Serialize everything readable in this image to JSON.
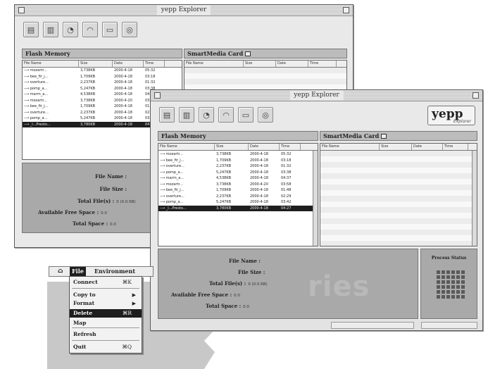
{
  "window_back": {
    "title": "yepp Explorer",
    "flash_header": "Flash Memory",
    "smart_header": "SmartMedia Card",
    "flash_columns": [
      "File Name",
      "Size",
      "Date",
      "Time"
    ],
    "smart_columns": [
      "File Name",
      "Size",
      "Date",
      "Time"
    ],
    "files": [
      {
        "name": "mozartr...",
        "size": "3,738KB",
        "date": "2000-4-18",
        "time": "05:32"
      },
      {
        "name": "bee_fir_j...",
        "size": "1,709KB",
        "date": "2000-4-18",
        "time": "03:18"
      },
      {
        "name": "overture...",
        "size": "2,237KB",
        "date": "2000-4-18",
        "time": "01:32"
      },
      {
        "name": "pomp_a...",
        "size": "5,247KB",
        "date": "2000-4-18",
        "time": "03:38"
      },
      {
        "name": "marrn_a...",
        "size": "4,538KB",
        "date": "2000-4-18",
        "time": "04:37"
      },
      {
        "name": "mozartr...",
        "size": "3,738KB",
        "date": "2000-4-20",
        "time": "03:58"
      },
      {
        "name": "bee_fir_j...",
        "size": "1,709KB",
        "date": "2000-4-18",
        "time": "01:48"
      },
      {
        "name": "overture...",
        "size": "2,237KB",
        "date": "2000-4-18",
        "time": "02:29"
      },
      {
        "name": "pomp_a...",
        "size": "5,247KB",
        "date": "2000-4-18",
        "time": "03:42"
      },
      {
        "name": "_l...Presto...",
        "size": "3,780KB",
        "date": "2000-4-18",
        "time": "04:27"
      }
    ],
    "info": {
      "file_name_label": "File Name :",
      "file_size_label": "File Size :",
      "total_files_label": "Total File(s) :",
      "total_files_value": "0 (0.0 KB)",
      "free_space_label": "Available Free Space :",
      "free_space_value": "0.0",
      "total_space_label": "Total Space :",
      "total_space_value": "0.0"
    }
  },
  "window_front": {
    "title": "yepp Explorer",
    "logo_text": "yepp",
    "logo_sub": "Explorer",
    "toolbar_icons": [
      "folder-icon",
      "trash-icon",
      "upload-icon",
      "download-icon",
      "card-icon",
      "settings-icon"
    ],
    "flash_header": "Flash Memory",
    "smart_header": "SmartMedia Card",
    "flash_columns": [
      "File Name",
      "Size",
      "Date",
      "Time"
    ],
    "smart_columns": [
      "File Name",
      "Size",
      "Date",
      "Time"
    ],
    "files": [
      {
        "name": "mozartr...",
        "size": "3,738KB",
        "date": "2000-4-18",
        "time": "05:32"
      },
      {
        "name": "bee_fir_j...",
        "size": "1,709KB",
        "date": "2000-4-18",
        "time": "03:18"
      },
      {
        "name": "overture...",
        "size": "2,237KB",
        "date": "2000-4-18",
        "time": "01:32"
      },
      {
        "name": "pomp_a...",
        "size": "5,247KB",
        "date": "2000-4-18",
        "time": "03:38"
      },
      {
        "name": "marrn_a...",
        "size": "4,538KB",
        "date": "2000-4-18",
        "time": "04:37"
      },
      {
        "name": "mozartr...",
        "size": "3,738KB",
        "date": "2000-4-20",
        "time": "03:58"
      },
      {
        "name": "bee_fir_j...",
        "size": "1,709KB",
        "date": "2000-4-18",
        "time": "01:48"
      },
      {
        "name": "overture...",
        "size": "2,237KB",
        "date": "2000-4-18",
        "time": "02:29"
      },
      {
        "name": "pomp_a...",
        "size": "5,247KB",
        "date": "2000-4-18",
        "time": "03:42"
      },
      {
        "name": "_l...Presto...",
        "size": "3,780KB",
        "date": "2000-4-18",
        "time": "04:27"
      }
    ],
    "info": {
      "file_name_label": "File Name :",
      "file_size_label": "File Size :",
      "total_files_label": "Total File(s) :",
      "total_files_value": "0 (0.0 KB)",
      "free_space_label": "Available Free Space :",
      "free_space_value": "0.0",
      "total_space_label": "Total Space :",
      "total_space_value": "0.0"
    },
    "watermark": "ries",
    "process_status": "Process Status"
  },
  "menu": {
    "apple": "",
    "file": "File",
    "environment": "Environment",
    "items": [
      {
        "label": "Connect",
        "shortcut": "⌘K",
        "submenu": false,
        "highlighted": false
      },
      {
        "label": "Copy to",
        "shortcut": "",
        "submenu": true,
        "highlighted": false
      },
      {
        "label": "Format",
        "shortcut": "",
        "submenu": true,
        "highlighted": false
      },
      {
        "label": "Delete",
        "shortcut": "⌘R",
        "submenu": false,
        "highlighted": true
      },
      {
        "label": "Map",
        "shortcut": "",
        "submenu": false,
        "highlighted": false
      },
      {
        "label": "Refresh",
        "shortcut": "",
        "submenu": false,
        "highlighted": false
      },
      {
        "label": "Quit",
        "shortcut": "⌘Q",
        "submenu": false,
        "highlighted": false
      }
    ]
  },
  "colors": {
    "window_bg": "#e9e9e9",
    "info_bg": "#a9a9a9",
    "selection": "#1e1e1e",
    "background": "#ffffff",
    "deco_shape": "#c8c8c8"
  }
}
